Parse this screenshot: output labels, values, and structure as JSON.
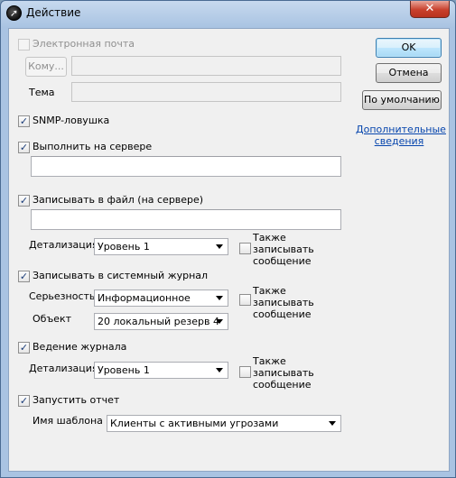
{
  "window": {
    "title": "Действие",
    "close_glyph": "✕",
    "app_icon": "arrow-icon"
  },
  "buttons": {
    "ok": "OK",
    "cancel": "Отмена",
    "defaults": "По умолчанию"
  },
  "more_info_link": "Дополнительные сведения",
  "email": {
    "label": "Электронная почта",
    "checked": false,
    "to_button": "Кому...",
    "to_value": "",
    "subject_label": "Тема",
    "subject_value": ""
  },
  "snmp": {
    "label": "SNMP-ловушка",
    "checked": true
  },
  "run_on_server": {
    "label": "Выполнить на сервере",
    "checked": true,
    "value": ""
  },
  "log_to_file": {
    "label": "Записывать в файл (на сервере)",
    "checked": true,
    "value": "",
    "detail_label": "Детализация",
    "detail_value": "Уровень 1",
    "also_log": "Также записывать сообщение",
    "also_log_checked": false
  },
  "syslog": {
    "label": "Записывать в системный журнал",
    "checked": true,
    "severity_label": "Серьезность",
    "severity_value": "Информационное",
    "facility_label": "Объект",
    "facility_value": "20 локальный резерв 4",
    "also_log": "Также записывать сообщение",
    "also_log_checked": false
  },
  "logging": {
    "label": "Ведение журнала",
    "checked": true,
    "detail_label": "Детализация",
    "detail_value": "Уровень 1",
    "also_log": "Также записывать сообщение",
    "also_log_checked": false
  },
  "run_report": {
    "label": "Запустить отчет",
    "checked": true,
    "template_label": "Имя шаблона",
    "template_value": "Клиенты с активными угрозами"
  }
}
